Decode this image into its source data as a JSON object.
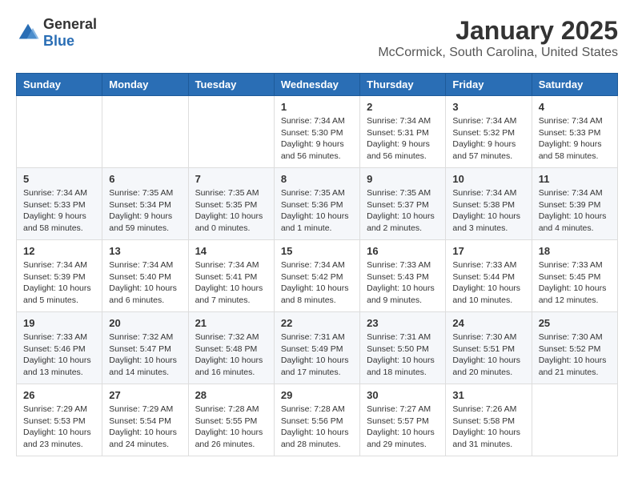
{
  "logo": {
    "general": "General",
    "blue": "Blue"
  },
  "header": {
    "month": "January 2025",
    "location": "McCormick, South Carolina, United States"
  },
  "weekdays": [
    "Sunday",
    "Monday",
    "Tuesday",
    "Wednesday",
    "Thursday",
    "Friday",
    "Saturday"
  ],
  "weeks": [
    [
      {
        "day": "",
        "info": ""
      },
      {
        "day": "",
        "info": ""
      },
      {
        "day": "",
        "info": ""
      },
      {
        "day": "1",
        "info": "Sunrise: 7:34 AM\nSunset: 5:30 PM\nDaylight: 9 hours\nand 56 minutes."
      },
      {
        "day": "2",
        "info": "Sunrise: 7:34 AM\nSunset: 5:31 PM\nDaylight: 9 hours\nand 56 minutes."
      },
      {
        "day": "3",
        "info": "Sunrise: 7:34 AM\nSunset: 5:32 PM\nDaylight: 9 hours\nand 57 minutes."
      },
      {
        "day": "4",
        "info": "Sunrise: 7:34 AM\nSunset: 5:33 PM\nDaylight: 9 hours\nand 58 minutes."
      }
    ],
    [
      {
        "day": "5",
        "info": "Sunrise: 7:34 AM\nSunset: 5:33 PM\nDaylight: 9 hours\nand 58 minutes."
      },
      {
        "day": "6",
        "info": "Sunrise: 7:35 AM\nSunset: 5:34 PM\nDaylight: 9 hours\nand 59 minutes."
      },
      {
        "day": "7",
        "info": "Sunrise: 7:35 AM\nSunset: 5:35 PM\nDaylight: 10 hours\nand 0 minutes."
      },
      {
        "day": "8",
        "info": "Sunrise: 7:35 AM\nSunset: 5:36 PM\nDaylight: 10 hours\nand 1 minute."
      },
      {
        "day": "9",
        "info": "Sunrise: 7:35 AM\nSunset: 5:37 PM\nDaylight: 10 hours\nand 2 minutes."
      },
      {
        "day": "10",
        "info": "Sunrise: 7:34 AM\nSunset: 5:38 PM\nDaylight: 10 hours\nand 3 minutes."
      },
      {
        "day": "11",
        "info": "Sunrise: 7:34 AM\nSunset: 5:39 PM\nDaylight: 10 hours\nand 4 minutes."
      }
    ],
    [
      {
        "day": "12",
        "info": "Sunrise: 7:34 AM\nSunset: 5:39 PM\nDaylight: 10 hours\nand 5 minutes."
      },
      {
        "day": "13",
        "info": "Sunrise: 7:34 AM\nSunset: 5:40 PM\nDaylight: 10 hours\nand 6 minutes."
      },
      {
        "day": "14",
        "info": "Sunrise: 7:34 AM\nSunset: 5:41 PM\nDaylight: 10 hours\nand 7 minutes."
      },
      {
        "day": "15",
        "info": "Sunrise: 7:34 AM\nSunset: 5:42 PM\nDaylight: 10 hours\nand 8 minutes."
      },
      {
        "day": "16",
        "info": "Sunrise: 7:33 AM\nSunset: 5:43 PM\nDaylight: 10 hours\nand 9 minutes."
      },
      {
        "day": "17",
        "info": "Sunrise: 7:33 AM\nSunset: 5:44 PM\nDaylight: 10 hours\nand 10 minutes."
      },
      {
        "day": "18",
        "info": "Sunrise: 7:33 AM\nSunset: 5:45 PM\nDaylight: 10 hours\nand 12 minutes."
      }
    ],
    [
      {
        "day": "19",
        "info": "Sunrise: 7:33 AM\nSunset: 5:46 PM\nDaylight: 10 hours\nand 13 minutes."
      },
      {
        "day": "20",
        "info": "Sunrise: 7:32 AM\nSunset: 5:47 PM\nDaylight: 10 hours\nand 14 minutes."
      },
      {
        "day": "21",
        "info": "Sunrise: 7:32 AM\nSunset: 5:48 PM\nDaylight: 10 hours\nand 16 minutes."
      },
      {
        "day": "22",
        "info": "Sunrise: 7:31 AM\nSunset: 5:49 PM\nDaylight: 10 hours\nand 17 minutes."
      },
      {
        "day": "23",
        "info": "Sunrise: 7:31 AM\nSunset: 5:50 PM\nDaylight: 10 hours\nand 18 minutes."
      },
      {
        "day": "24",
        "info": "Sunrise: 7:30 AM\nSunset: 5:51 PM\nDaylight: 10 hours\nand 20 minutes."
      },
      {
        "day": "25",
        "info": "Sunrise: 7:30 AM\nSunset: 5:52 PM\nDaylight: 10 hours\nand 21 minutes."
      }
    ],
    [
      {
        "day": "26",
        "info": "Sunrise: 7:29 AM\nSunset: 5:53 PM\nDaylight: 10 hours\nand 23 minutes."
      },
      {
        "day": "27",
        "info": "Sunrise: 7:29 AM\nSunset: 5:54 PM\nDaylight: 10 hours\nand 24 minutes."
      },
      {
        "day": "28",
        "info": "Sunrise: 7:28 AM\nSunset: 5:55 PM\nDaylight: 10 hours\nand 26 minutes."
      },
      {
        "day": "29",
        "info": "Sunrise: 7:28 AM\nSunset: 5:56 PM\nDaylight: 10 hours\nand 28 minutes."
      },
      {
        "day": "30",
        "info": "Sunrise: 7:27 AM\nSunset: 5:57 PM\nDaylight: 10 hours\nand 29 minutes."
      },
      {
        "day": "31",
        "info": "Sunrise: 7:26 AM\nSunset: 5:58 PM\nDaylight: 10 hours\nand 31 minutes."
      },
      {
        "day": "",
        "info": ""
      }
    ]
  ]
}
